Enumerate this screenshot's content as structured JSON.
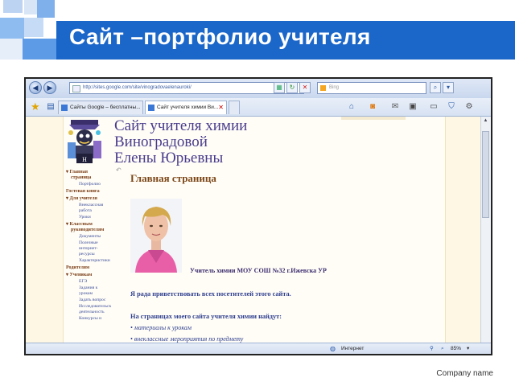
{
  "slide": {
    "title": "Сайт –портфолио учителя",
    "company": "Company name"
  },
  "browser": {
    "url": "http://sites.google.com/site/vinogradovaelenauroki/",
    "search_placeholder": "Bing",
    "tabs": [
      {
        "label": "Сайты Google – бесплатны..."
      },
      {
        "label": "Сайт учителя химии Ви..."
      }
    ],
    "status": {
      "zone": "Интернет",
      "zoom": "85%"
    }
  },
  "site": {
    "title_lines": [
      "Сайт учителя химии",
      "Виноградовой",
      "Елены Юрьевны"
    ],
    "heading": "Главная страница",
    "caption": "Учитель химии МОУ СОШ №32 г.Ижевска УР",
    "welcome": "Я рада приветствовать всех посетителей этого сайта.",
    "find_text": "На страницах моего сайта учителя химии найдут:",
    "bullets": [
      "• материалы к урокам",
      "• внеклассные мероприятия по предмету"
    ],
    "nav": [
      {
        "type": "main",
        "label": "▾ Главная"
      },
      {
        "type": "main2",
        "label": "страница"
      },
      {
        "type": "sub",
        "label": "Портфолио"
      },
      {
        "type": "main",
        "label": "Гостевая книга"
      },
      {
        "type": "main",
        "label": "▾ Для учителя"
      },
      {
        "type": "sub",
        "label": "Внеклассная"
      },
      {
        "type": "sub2",
        "label": "работа"
      },
      {
        "type": "sub",
        "label": "Уроки"
      },
      {
        "type": "main",
        "label": "▾ Классным"
      },
      {
        "type": "main2",
        "label": "руководителям"
      },
      {
        "type": "sub",
        "label": "Документы"
      },
      {
        "type": "sub",
        "label": "Полезные"
      },
      {
        "type": "sub2",
        "label": "интернет-"
      },
      {
        "type": "sub2",
        "label": "ресурсы"
      },
      {
        "type": "sub",
        "label": "Характеристики"
      },
      {
        "type": "main",
        "label": "Родителям"
      },
      {
        "type": "main",
        "label": "▾ Ученикам"
      },
      {
        "type": "sub",
        "label": "ЕГЭ"
      },
      {
        "type": "sub",
        "label": "Задания к"
      },
      {
        "type": "sub2",
        "label": "урокам"
      },
      {
        "type": "sub",
        "label": "Задать вопрос"
      },
      {
        "type": "sub",
        "label": "Исследовательск"
      },
      {
        "type": "sub2",
        "label": "деятельность"
      },
      {
        "type": "sub",
        "label": "Конкурсы и"
      }
    ]
  }
}
